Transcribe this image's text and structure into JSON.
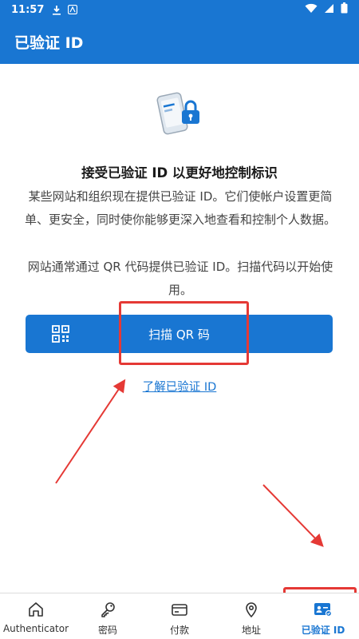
{
  "status_bar": {
    "time": "11:57"
  },
  "app_bar": {
    "title": "已验证 ID"
  },
  "content": {
    "heading": "接受已验证 ID 以更好地控制标识",
    "description_line1": "某些网站和组织现在提供已验证 ID。它们使帐户设置更简",
    "description_line2": "单、更安全，同时使你能够更深入地查看和控制个人数据。",
    "info_line1": "网站通常通过 QR 代码提供已验证 ID。扫描代码以开始使",
    "info_line2": "用。",
    "scan_button_label": "扫描 QR 码",
    "learn_more_link": "了解已验证 ID"
  },
  "bottom_nav": {
    "items": [
      {
        "label": "Authenticator",
        "icon": "home-icon"
      },
      {
        "label": "密码",
        "icon": "key-icon"
      },
      {
        "label": "付款",
        "icon": "credit-card-icon"
      },
      {
        "label": "地址",
        "icon": "location-pin-icon"
      },
      {
        "label": "已验证 ID",
        "icon": "verified-id-icon",
        "active": true
      }
    ]
  },
  "colors": {
    "primary": "#1976D2",
    "annotation": "#E53935"
  }
}
